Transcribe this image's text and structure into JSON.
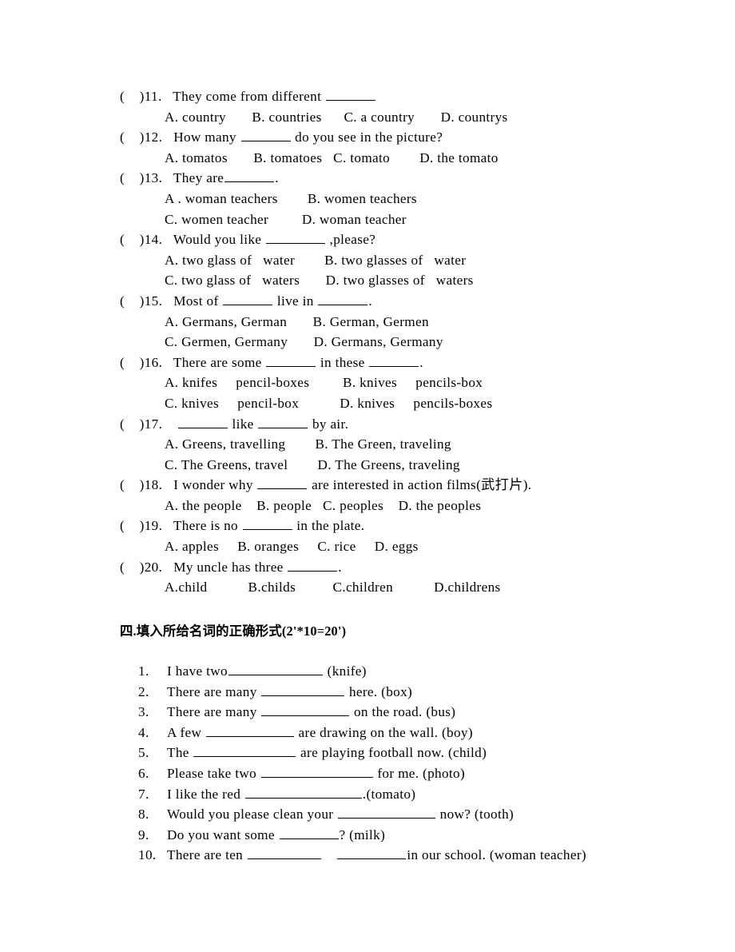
{
  "document": {
    "multiple_choice": [
      {
        "marker_open": "(",
        "marker_close": ")",
        "number": "11.",
        "stem_before": "They come from different ",
        "stem_after": "",
        "blank_size": "b-md",
        "option_lines": [
          "A. country       B. countries      C. a country       D. countrys"
        ]
      },
      {
        "marker_open": "(",
        "marker_close": ")",
        "number": "12.",
        "stem_before": "How many ",
        "stem_after": " do you see in the picture?",
        "blank_size": "b-md",
        "option_lines": [
          "A. tomatos       B. tomatoes   C. tomato        D. the tomato"
        ]
      },
      {
        "marker_open": "(",
        "marker_close": ")",
        "number": "13.",
        "stem_before": "They are",
        "stem_after": ".",
        "blank_size": "b-md",
        "option_lines": [
          "A . woman teachers        B. women teachers",
          "C. women teacher         D. woman teacher"
        ]
      },
      {
        "marker_open": "(",
        "marker_close": ")",
        "number": "14.",
        "stem_before": "Would you like ",
        "stem_after": " ,please?",
        "blank_size": "b-lg",
        "option_lines": [
          "A. two glass of   water        B. two glasses of   water",
          "C. two glass of   waters       D. two glasses of   waters"
        ]
      },
      {
        "marker_open": "(",
        "marker_close": ")",
        "number": "15.",
        "stem_before": "Most of ",
        "stem_after": ".",
        "blank_size": "b-md",
        "stem_middle": " live in ",
        "blank2_size": "b-md",
        "option_lines": [
          "A. Germans, German       B. German, Germen",
          "C. Germen, Germany       D. Germans, Germany"
        ]
      },
      {
        "marker_open": "(",
        "marker_close": ")",
        "number": "16.",
        "stem_before": "There are some ",
        "stem_middle": " in these ",
        "stem_after": ".",
        "blank_size": "b-md",
        "blank2_size": "b-md",
        "option_lines": [
          "A. knifes     pencil-boxes         B. knives     pencils-box",
          "C. knives     pencil-box           D. knives     pencils-boxes"
        ]
      },
      {
        "marker_open": "(",
        "marker_close": ")",
        "number": "17.",
        "stem_before": " ",
        "stem_middle": " like ",
        "stem_after": " by air.",
        "blank_size": "b-md",
        "blank2_size": "b-md",
        "option_lines": [
          "A. Greens, travelling        B. The Green, traveling",
          "C. The Greens, travel        D. The Greens, traveling"
        ]
      },
      {
        "marker_open": "(",
        "marker_close": ")",
        "number": "18.",
        "stem_before": "I wonder why ",
        "stem_after": " are interested in action films(武打片).",
        "blank_size": "b-md",
        "option_lines": [
          "A. the people    B. people   C. peoples    D. the peoples"
        ]
      },
      {
        "marker_open": "(",
        "marker_close": ")",
        "number": "19.",
        "stem_before": "There is no ",
        "stem_after": " in the plate.",
        "blank_size": "b-md",
        "option_lines": [
          "A. apples     B. oranges     C. rice     D. eggs"
        ]
      },
      {
        "marker_open": "(",
        "marker_close": ")",
        "number": "20.",
        "stem_before": "My uncle has three ",
        "stem_after": ".",
        "blank_size": "b-md",
        "option_lines": [
          "A.child           B.childs          C.children           D.childrens"
        ]
      }
    ],
    "section_heading": "四.填入所给名词的正确形式(2'*10=20')",
    "fill_in_items": [
      {
        "number": "1.",
        "text_before": "I have two",
        "blank_class": "f-1",
        "text_after": " (knife)"
      },
      {
        "number": "2.",
        "text_before": "There are many ",
        "blank_class": "f-2",
        "text_after": " here. (box)"
      },
      {
        "number": "3.",
        "text_before": "There are many ",
        "blank_class": "f-3",
        "text_after": " on the road. (bus)"
      },
      {
        "number": "4.",
        "text_before": "A few ",
        "blank_class": "f-4",
        "text_after": " are drawing on the wall. (boy)"
      },
      {
        "number": "5.",
        "text_before": "The ",
        "blank_class": "f-5",
        "text_after": " are playing football now. (child)"
      },
      {
        "number": "6.",
        "text_before": "Please take two ",
        "blank_class": "f-6",
        "text_after": " for me. (photo)"
      },
      {
        "number": "7.",
        "text_before": "I like the red ",
        "blank_class": "f-7",
        "text_after": ".(tomato)"
      },
      {
        "number": "8.",
        "text_before": "Would you please clean your ",
        "blank_class": "f-8",
        "text_after": " now? (tooth)"
      },
      {
        "number": "9.",
        "text_before": "Do you want some ",
        "blank_class": "f-9",
        "text_after": "? (milk)"
      },
      {
        "number": "10.",
        "text_before": "There are ten ",
        "blank_class": "f-10a",
        "text_middle": "    ",
        "blank2_class": "f-10b",
        "text_after": "in our school. (woman teacher)"
      }
    ]
  }
}
